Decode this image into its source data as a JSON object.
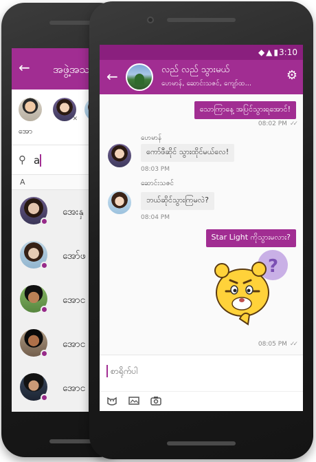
{
  "back_screen": {
    "header": {
      "title": "အဖွဲ့အသ"
    },
    "selected_members": [
      {
        "name": "အော"
      },
      {
        "name": ""
      },
      {
        "name": ""
      }
    ],
    "search": {
      "value": "a",
      "placeholder": ""
    },
    "section_letter": "A",
    "contacts": [
      {
        "name": "အေးနှ"
      },
      {
        "name": "အော်ဖ"
      },
      {
        "name": "အောင"
      },
      {
        "name": "အောင"
      },
      {
        "name": "အောင"
      }
    ],
    "colors": {
      "accent": "#a12d92"
    }
  },
  "front_screen": {
    "status_bar": {
      "time": "3:10"
    },
    "header": {
      "title": "လည် လည် သွားမယ်",
      "subtitle": "ဟေမာန်, ဆောင်းသဇင်, ကျော်ထ..."
    },
    "messages": [
      {
        "id": "m1",
        "direction": "out",
        "text": "သောကြာနေ့ အပြင်သွားရအောင်!",
        "time": "08:02 PM"
      },
      {
        "id": "m2",
        "direction": "in",
        "sender": "ဟေမာန်",
        "text": "ကော်ဖီဆိုင် သွားထိုင်မယ်လေ!",
        "time": "08:03 PM"
      },
      {
        "id": "m3",
        "direction": "in",
        "sender": "ဆောင်းသဇင်",
        "text": "ဘယ်ဆိုင်သွားကြမလဲ?",
        "time": "08:04 PM"
      },
      {
        "id": "m4",
        "direction": "out",
        "text": "Star Light ကိုသွားမလား?",
        "time": ""
      },
      {
        "id": "m5",
        "direction": "out",
        "sticker": "confused-tiger-sticker",
        "time": "08:05 PM"
      }
    ],
    "composer": {
      "placeholder": "စာရိုက်ပါ",
      "tools": [
        "sticker-icon",
        "photo-icon",
        "camera-icon"
      ]
    },
    "colors": {
      "accent": "#a12d92",
      "status_bar": "#8a1f7e",
      "incoming_bubble": "#eeeeee"
    }
  }
}
